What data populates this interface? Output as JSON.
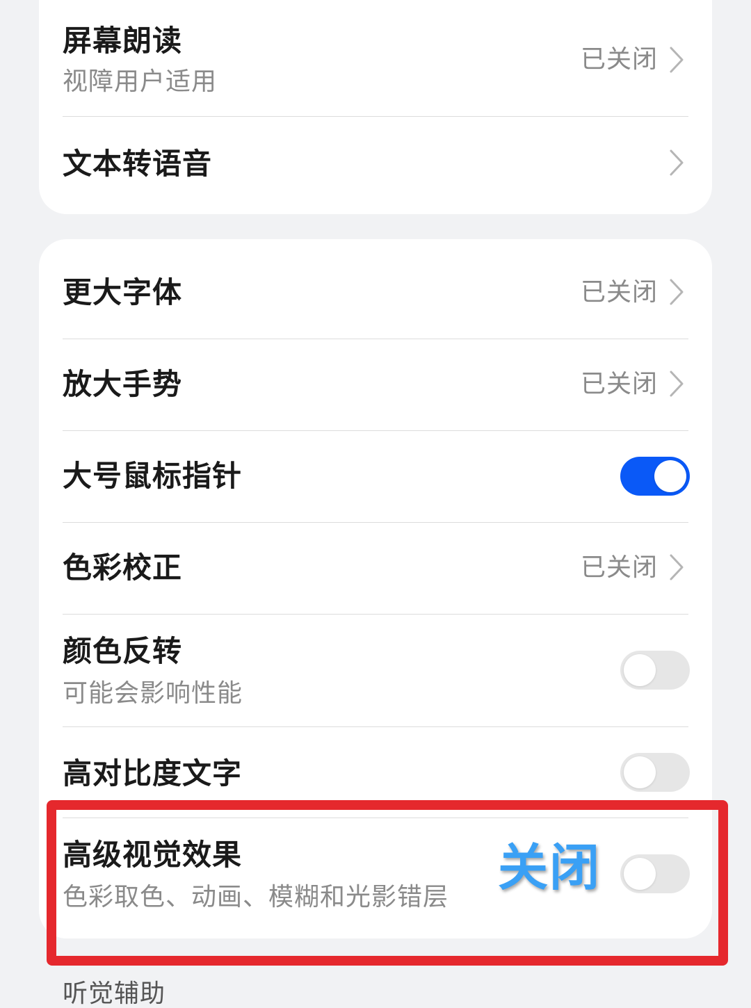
{
  "group1": {
    "items": [
      {
        "title": "屏幕朗读",
        "subtitle": "视障用户适用",
        "status": "已关闭"
      },
      {
        "title": "文本转语音"
      }
    ]
  },
  "group2": {
    "items": [
      {
        "title": "更大字体",
        "status": "已关闭"
      },
      {
        "title": "放大手势",
        "status": "已关闭"
      },
      {
        "title": "大号鼠标指针",
        "toggle_on": true
      },
      {
        "title": "色彩校正",
        "status": "已关闭"
      },
      {
        "title": "颜色反转",
        "subtitle": "可能会影响性能",
        "toggle_on": false
      },
      {
        "title": "高对比度文字",
        "toggle_on": false
      },
      {
        "title": "高级视觉效果",
        "subtitle": "色彩取色、动画、模糊和光影错层",
        "toggle_on": false
      }
    ]
  },
  "annotation": {
    "label": "关闭",
    "box_color": "#e5282d",
    "text_color": "#3aa0f5"
  },
  "next_section": {
    "title": "听觉辅助"
  },
  "colors": {
    "accent": "#0a59f7",
    "background": "#f1f2f4",
    "card": "#ffffff"
  }
}
